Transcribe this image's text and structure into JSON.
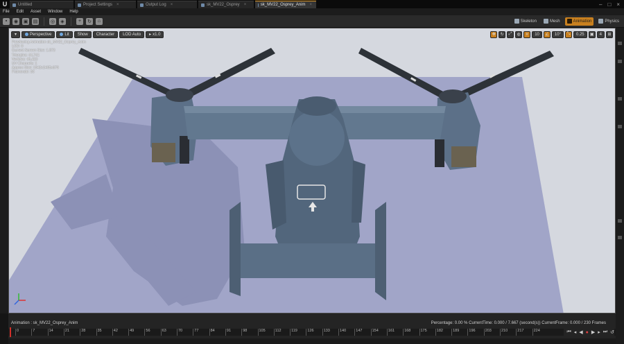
{
  "tabs": [
    {
      "label": "Untitled"
    },
    {
      "label": "Project Settings"
    },
    {
      "label": "Output Log"
    },
    {
      "label": "sk_MV22_Osprey"
    },
    {
      "label": "sk_MV22_Osprey_Anim"
    }
  ],
  "menu": [
    "File",
    "Edit",
    "Asset",
    "Window",
    "Help"
  ],
  "modes": [
    {
      "label": "Skeleton",
      "active": false
    },
    {
      "label": "Mesh",
      "active": false
    },
    {
      "label": "Animation",
      "active": true
    },
    {
      "label": "Physics",
      "active": false
    }
  ],
  "viewport": {
    "perspective": "Perspective",
    "lit": "Lit",
    "show": "Show",
    "character": "Character",
    "lod": "LOD Auto",
    "speed": "x1.0",
    "grid_snap": "10",
    "rot_snap": "10°",
    "scale_snap": "0.25",
    "cam_speed": "4"
  },
  "info_lines": [
    "Previewing Animation sk_MV22_Osprey_Anim",
    "LOD: 0",
    "Current Screen Size: 1.873",
    "Triangles: 44,741",
    "Vertices: 45,423",
    "UV Channels: 1",
    "Approx Size: 1942x2465x679",
    "Framerate: 30"
  ],
  "timeline": {
    "animation": "Animation : sk_MV22_Osprey_Anim",
    "stats": "Percentage: 0.00 % CurrentTime: 0.000 / 7.667 (second(s)) CurrentFrame: 0.000 / 230 Frames",
    "ticks": [
      "0",
      "7",
      "14",
      "21",
      "28",
      "35",
      "42",
      "49",
      "56",
      "63",
      "70",
      "77",
      "84",
      "91",
      "98",
      "105",
      "112",
      "119",
      "126",
      "133",
      "140",
      "147",
      "154",
      "161",
      "168",
      "175",
      "182",
      "189",
      "196",
      "203",
      "210",
      "217",
      "224"
    ]
  },
  "colors": {
    "accent": "#c8801f",
    "floor": "#9ea3c6",
    "background": "#d5d8df",
    "aircraft": "#55697f"
  }
}
